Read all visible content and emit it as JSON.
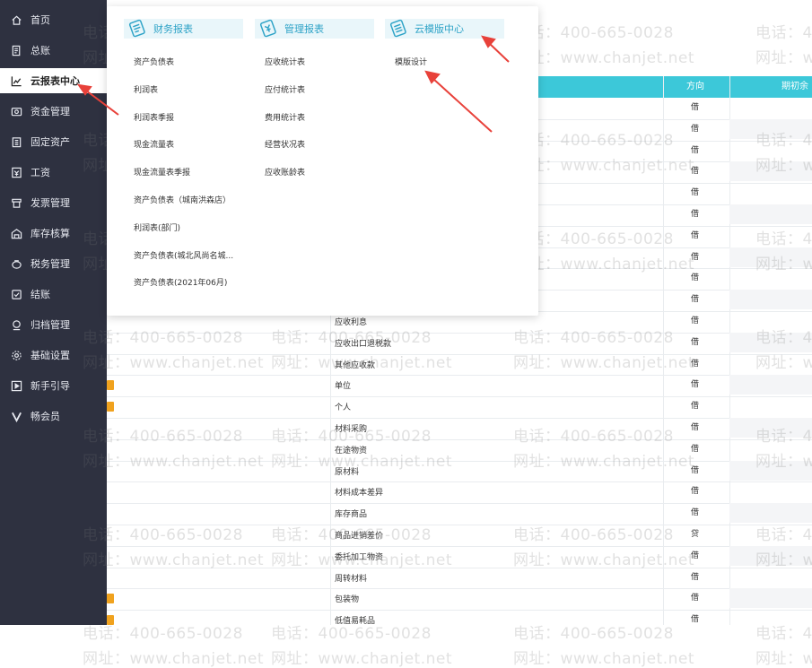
{
  "sidebar": {
    "items": [
      {
        "label": "首页",
        "icon": "home-icon"
      },
      {
        "label": "总账",
        "icon": "ledger-icon"
      },
      {
        "label": "云报表中心",
        "icon": "chart-icon",
        "active": true
      },
      {
        "label": "资金管理",
        "icon": "money-icon"
      },
      {
        "label": "固定资产",
        "icon": "building-icon"
      },
      {
        "label": "工资",
        "icon": "salary-icon"
      },
      {
        "label": "发票管理",
        "icon": "invoice-icon"
      },
      {
        "label": "库存核算",
        "icon": "warehouse-icon"
      },
      {
        "label": "税务管理",
        "icon": "tax-icon"
      },
      {
        "label": "结账",
        "icon": "checkout-icon"
      },
      {
        "label": "归档管理",
        "icon": "archive-icon"
      },
      {
        "label": "基础设置",
        "icon": "gear-icon"
      },
      {
        "label": "新手引导",
        "icon": "guide-icon"
      },
      {
        "label": "畅会员",
        "icon": "vip-icon"
      }
    ]
  },
  "dropdown": {
    "columns": [
      {
        "title": "财务报表",
        "items": [
          "资产负债表",
          "利润表",
          "利润表季报",
          "现金流量表",
          "现金流量表季报",
          "资产负债表（城南洪森店）",
          "利润表(部门)",
          "资产负债表(城北风尚名城...",
          "资产负债表(2021年06月)"
        ]
      },
      {
        "title": "管理报表",
        "items": [
          "应收统计表",
          "应付统计表",
          "费用统计表",
          "经营状况表",
          "应收账龄表"
        ]
      },
      {
        "title": "云模版中心",
        "items": [
          "模版设计"
        ]
      }
    ]
  },
  "table": {
    "headers": {
      "direction": "方向",
      "opening": "期初余"
    },
    "rows": [
      {
        "name": "",
        "dir": "借"
      },
      {
        "name": "",
        "dir": "借"
      },
      {
        "name": "",
        "dir": "借"
      },
      {
        "name": "",
        "dir": "借"
      },
      {
        "name": "",
        "dir": "借"
      },
      {
        "name": "",
        "dir": "借"
      },
      {
        "name": "",
        "dir": "借"
      },
      {
        "name": "",
        "dir": "借"
      },
      {
        "name": "",
        "dir": "借"
      },
      {
        "name": "",
        "dir": "借"
      },
      {
        "name": "应收利息",
        "dir": "借"
      },
      {
        "name": "应收出口退税款",
        "dir": "借"
      },
      {
        "name": "其他应收款",
        "dir": "借"
      },
      {
        "name": "单位",
        "dir": "借",
        "tag": true
      },
      {
        "name": "个人",
        "dir": "借",
        "tag": true
      },
      {
        "name": "材料采购",
        "dir": "借"
      },
      {
        "name": "在途物资",
        "dir": "借"
      },
      {
        "name": "原材料",
        "dir": "借"
      },
      {
        "name": "材料成本差异",
        "dir": "借"
      },
      {
        "name": "库存商品",
        "dir": "借"
      },
      {
        "name": "商品进销差价",
        "dir": "贷"
      },
      {
        "name": "委托加工物资",
        "dir": "借"
      },
      {
        "name": "周转材料",
        "dir": "借"
      },
      {
        "name": "包装物",
        "dir": "借",
        "tag": true
      },
      {
        "name": "低值易耗品",
        "dir": "借",
        "tag": true
      }
    ]
  },
  "watermark": {
    "phone": "电话：400-665-0028",
    "site": "网址：www.chanjet.net"
  },
  "colors": {
    "sidebar_bg": "#2e3140",
    "header_teal": "#3cc8d9",
    "accent_blue": "#2ea3c7",
    "arrow_red": "#e8413a",
    "tag_orange": "#f0a21e"
  }
}
